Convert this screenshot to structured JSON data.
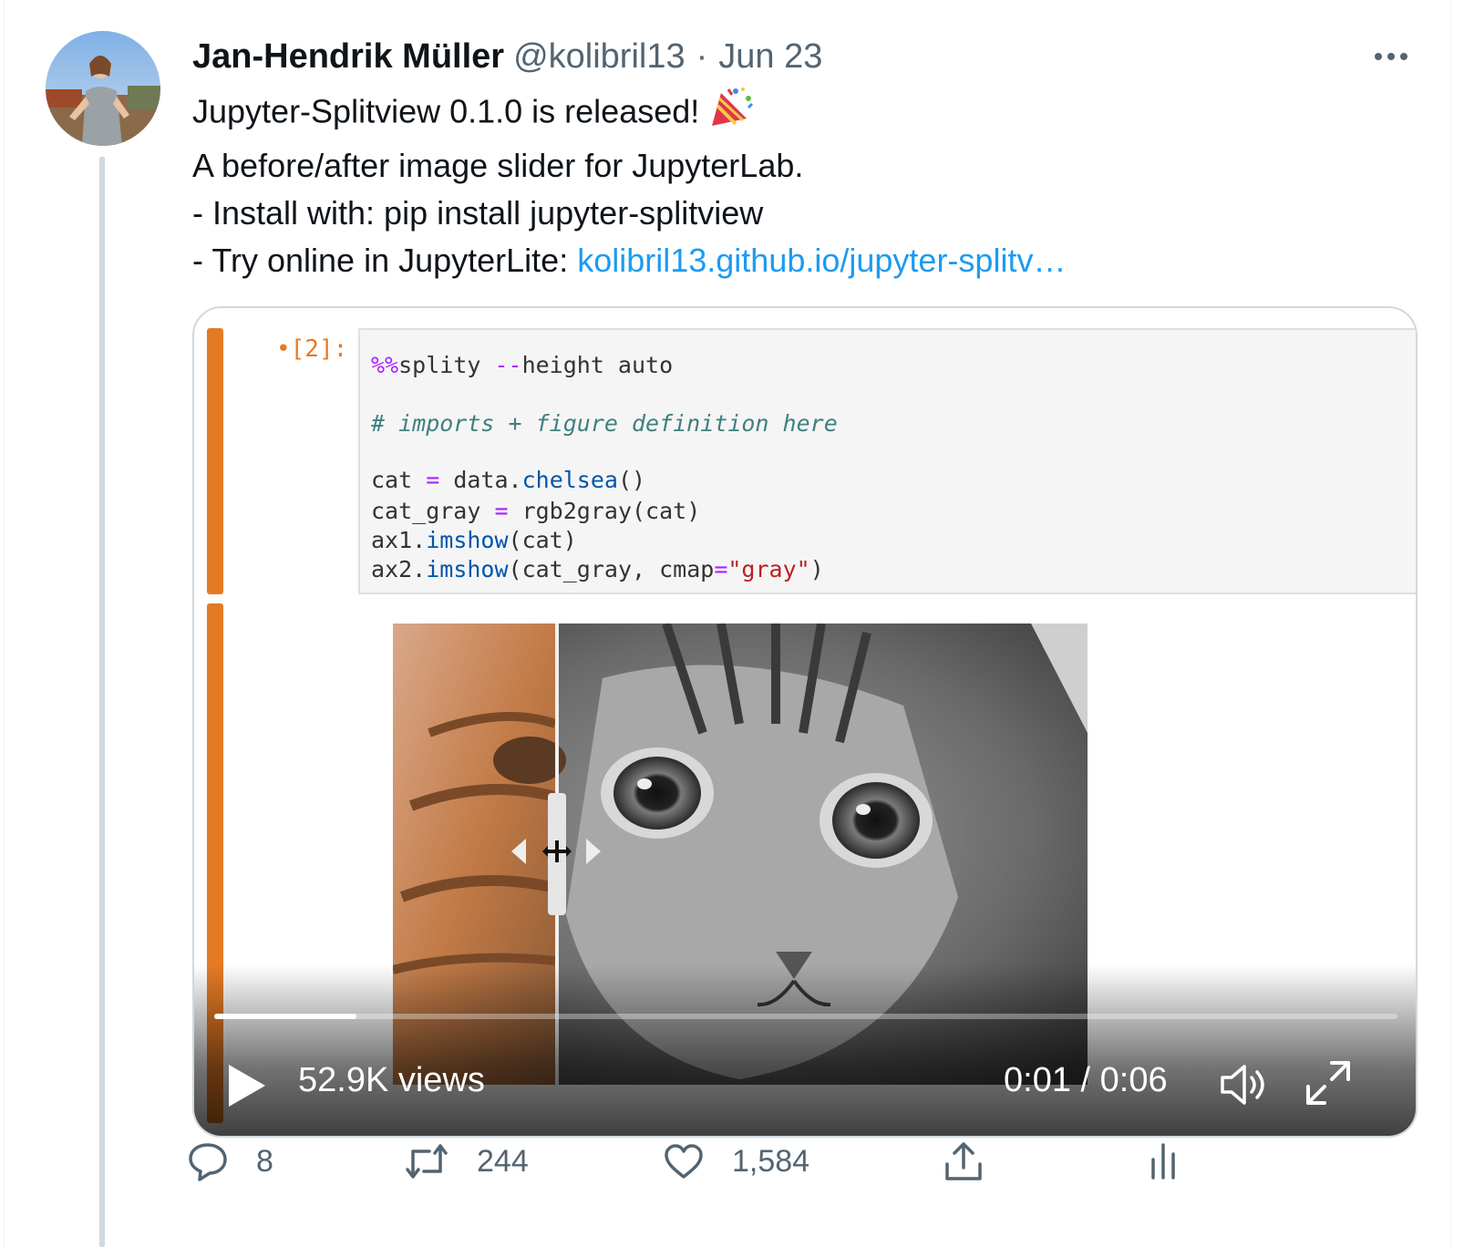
{
  "author": {
    "name": "Jan-Hendrik Müller",
    "handle": "@kolibril13",
    "separator": "·",
    "date": "Jun 23"
  },
  "tweet": {
    "line1": "Jupyter-Splitview 0.1.0 is released!",
    "line2": "A before/after image slider for JupyterLab.",
    "line3": "- Install with: pip install jupyter-splitview",
    "line4_prefix": "- Try online in JupyterLite: ",
    "link_text": "kolibril13.github.io/jupyter-splitv…",
    "emoji": "party-popper-icon"
  },
  "notebook": {
    "prompt": "•[2]:",
    "code": {
      "magic": "%%",
      "magic_rest": "splity ",
      "op_dashes": "--",
      "args": "height auto",
      "comment": "# imports + figure definition here",
      "l3a": "cat ",
      "l3eq": "=",
      "l3b": " data.",
      "l3fn": "chelsea",
      "l3c": "()",
      "l4a": "cat_gray ",
      "l4eq": "=",
      "l4b": " rgb2gray(cat)",
      "l5a": "ax1.",
      "l5fn": "imshow",
      "l5b": "(cat)",
      "l6a": "ax2.",
      "l6fn": "imshow",
      "l6b": "(cat_gray, cmap",
      "l6eq": "=",
      "l6str": "\"gray\"",
      "l6c": ")"
    }
  },
  "video": {
    "views": "52.9K views",
    "time": "0:01 / 0:06",
    "progress": 0.12
  },
  "actions": {
    "reply_count": "8",
    "retweet_count": "244",
    "like_count": "1,584"
  },
  "colors": {
    "link": "#1d9bf0",
    "secondary": "#536471",
    "notebook_accent": "#e57a25"
  }
}
